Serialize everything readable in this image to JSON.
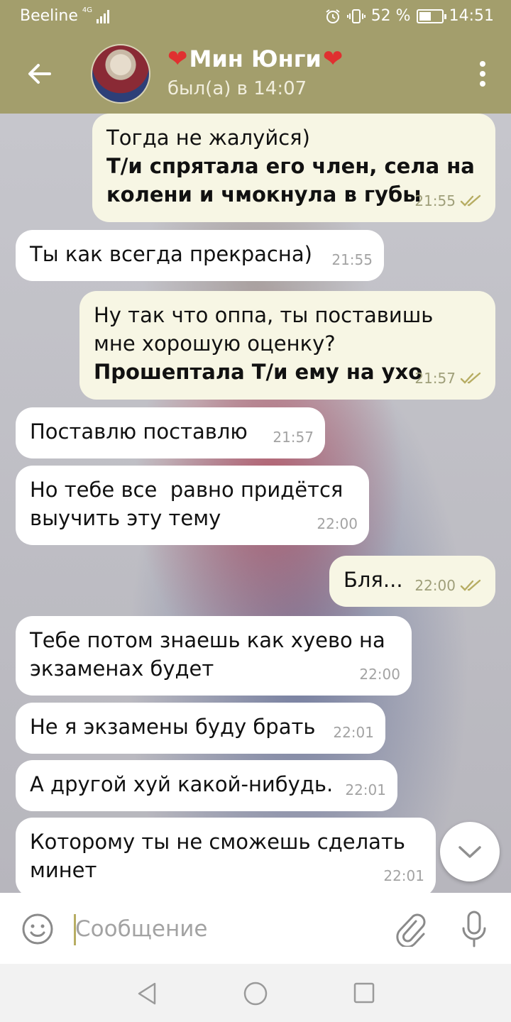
{
  "status_bar": {
    "carrier": "Beeline",
    "network": "4G",
    "battery": "52 %",
    "battery_level": 0.52,
    "time": "14:51"
  },
  "header": {
    "contact_name": "Мин Юнги",
    "presence": "был(а) в 14:07",
    "heart": "❤"
  },
  "messages": [
    {
      "dir": "out",
      "time": "21:55",
      "read": true,
      "plain": "Тогда не жалуйся)",
      "bold": "Т/и спрятала его член, села на\nколени и чмокнула в губы"
    },
    {
      "dir": "in",
      "time": "21:55",
      "text": "Ты как всегда прекрасна)"
    },
    {
      "dir": "out",
      "time": "21:57",
      "read": true,
      "plain": "Ну так что оппа, ты поставишь\nмне хорошую оценку?",
      "bold": "Прошептала Т/и ему на ухо"
    },
    {
      "dir": "in",
      "time": "21:57",
      "text": "Поставлю поставлю"
    },
    {
      "dir": "in",
      "time": "22:00",
      "text": "Но тебе все  равно придётся\nвыучить эту тему"
    },
    {
      "dir": "out",
      "time": "22:00",
      "read": true,
      "text": "Бля..."
    },
    {
      "dir": "in",
      "time": "22:00",
      "text": "Тебе потом знаешь как хуево на\nэкзаменах будет"
    },
    {
      "dir": "in",
      "time": "22:01",
      "text": "Не я экзамены буду брать"
    },
    {
      "dir": "in",
      "time": "22:01",
      "text": "А другой хуй какой-нибудь."
    },
    {
      "dir": "in",
      "time": "22:01",
      "text": "Которому ты не сможешь сделать\nминет"
    }
  ],
  "composer": {
    "placeholder": "Сообщение"
  },
  "colors": {
    "header": "#a39e6c",
    "outgoing_bubble": "#f7f6e4",
    "incoming_bubble": "#ffffff",
    "read_checks": "#b7ad63"
  },
  "icons": [
    "back-arrow-icon",
    "more-vert-icon",
    "double-check-icon",
    "chevron-down-icon",
    "emoji-icon",
    "paperclip-icon",
    "microphone-icon",
    "nav-back-icon",
    "nav-home-icon",
    "nav-recents-icon"
  ]
}
